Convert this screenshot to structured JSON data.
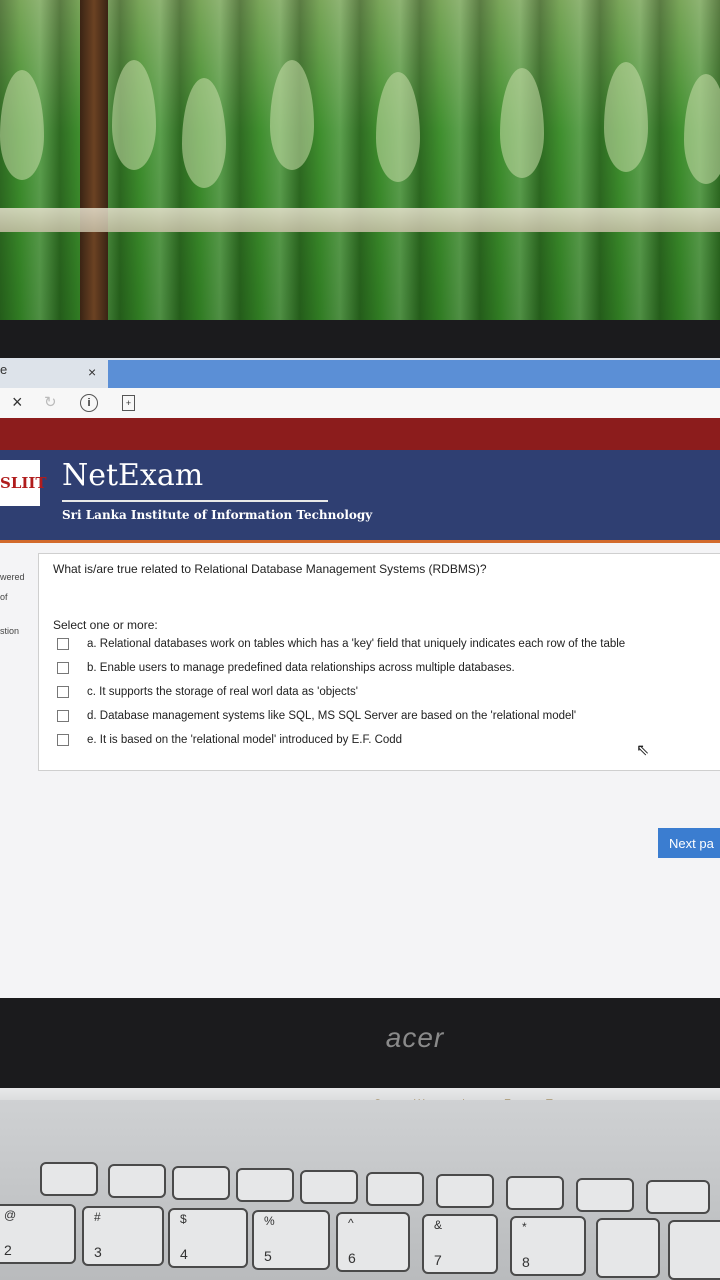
{
  "browser": {
    "tab_fragment": "e",
    "tab_close": "×",
    "stop_icon": "×",
    "info_icon": "i",
    "doc_icon": "+"
  },
  "header": {
    "logo_text": "SLIIT",
    "brand": "NetExam",
    "subtitle": "Sri Lanka Institute of Information Technology"
  },
  "sidebar": {
    "line1": "wered",
    "line2": "of",
    "line3": "stion"
  },
  "question": {
    "text": "What is/are true related to Relational Database Management Systems (RDBMS)?",
    "prompt": "Select one or more:",
    "options": [
      "a. Relational databases work on tables which has a 'key' field that uniquely indicates each row of the table",
      "b. Enable users to manage predefined data relationships across multiple databases.",
      "c. It supports the storage of real worl data as 'objects'",
      "d. Database management systems like SQL, MS SQL Server are based on the 'relational model'",
      "e. It is based on the 'relational model' introduced by E.F. Codd"
    ]
  },
  "next_button": "Next pa",
  "laptop_brand": "acer",
  "deck_indicators": [
    "S",
    "W",
    "I",
    "F",
    "T"
  ],
  "keys": [
    {
      "top": "@",
      "bottom": "2"
    },
    {
      "top": "#",
      "bottom": "3"
    },
    {
      "top": "$",
      "bottom": "4"
    },
    {
      "top": "%",
      "bottom": "5"
    },
    {
      "top": "^",
      "bottom": "6"
    },
    {
      "top": "&",
      "bottom": "7"
    },
    {
      "top": "*",
      "bottom": "8"
    }
  ],
  "colors": {
    "header_bg": "#2f3f72",
    "red_bar": "#8c1c1c",
    "button_blue": "#3b7dd0"
  }
}
